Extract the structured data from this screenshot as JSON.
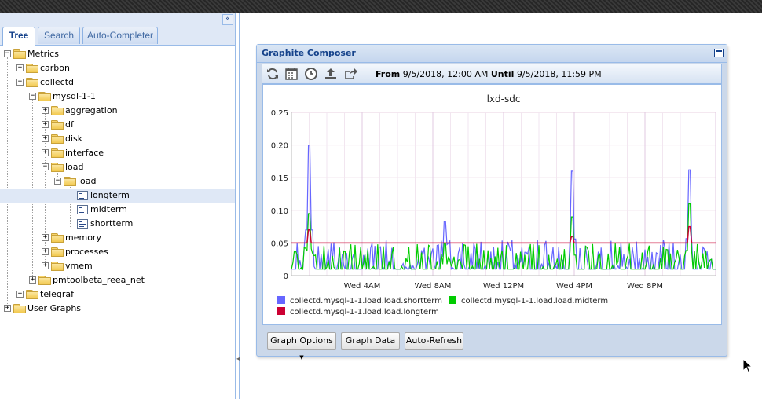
{
  "tabs": [
    {
      "label": "Tree",
      "active": true
    },
    {
      "label": "Search",
      "active": false
    },
    {
      "label": "Auto-Completer",
      "active": false
    }
  ],
  "tree": {
    "metrics": "Metrics",
    "carbon": "carbon",
    "collectd": "collectd",
    "mysql": "mysql-1-1",
    "aggregation": "aggregation",
    "df": "df",
    "disk": "disk",
    "interface": "interface",
    "load": "load",
    "load_inner": "load",
    "longterm": "longterm",
    "midterm": "midterm",
    "shortterm": "shortterm",
    "memory": "memory",
    "processes": "processes",
    "vmem": "vmem",
    "pmtoolbeta": "pmtoolbeta_reea_net",
    "telegraf": "telegraf",
    "user_graphs": "User Graphs"
  },
  "composer": {
    "title": "Graphite Composer",
    "range_from_label": "From",
    "range_from": "9/5/2018, 12:00 AM",
    "range_until_label": "Until",
    "range_until": "9/5/2018, 11:59 PM",
    "buttons": {
      "graph_options": "Graph Options",
      "graph_data": "Graph Data",
      "auto_refresh": "Auto-Refresh"
    },
    "toolbar_icons": [
      "refresh-icon",
      "calendar-icon",
      "clock-icon",
      "upload-icon",
      "share-icon"
    ]
  },
  "chart_data": {
    "type": "line",
    "title": "lxd-sdc",
    "ylim": [
      0,
      0.25
    ],
    "y_ticks": [
      "0.25",
      "0.20",
      "0.15",
      "0.10",
      "0.05",
      "0"
    ],
    "x_ticks": [
      "Wed  4AM",
      "Wed  8AM",
      "Wed 12PM",
      "Wed  4PM",
      "Wed  8PM"
    ],
    "x_hours": [
      4,
      8,
      12,
      16,
      20
    ],
    "xlim_hours": [
      0,
      24
    ],
    "series": [
      {
        "name": "collectd.mysql-1-1.load.load.shortterm",
        "color": "#6666ff",
        "peaks": [
          {
            "x": 1.0,
            "y": 0.2
          },
          {
            "x": 8.7,
            "y": 0.083
          },
          {
            "x": 15.9,
            "y": 0.16
          },
          {
            "x": 22.5,
            "y": 0.162
          }
        ],
        "baseline": 0.01,
        "noise_max": 0.045
      },
      {
        "name": "collectd.mysql-1-1.load.load.midterm",
        "color": "#00cc00",
        "peaks": [
          {
            "x": 1.0,
            "y": 0.095
          },
          {
            "x": 8.7,
            "y": 0.05
          },
          {
            "x": 15.9,
            "y": 0.09
          },
          {
            "x": 22.5,
            "y": 0.11
          }
        ],
        "baseline": 0.01,
        "noise_max": 0.04
      },
      {
        "name": "collectd.mysql-1-1.load.load.longterm",
        "color": "#cc0033",
        "level": 0.05,
        "peaks": [
          {
            "x": 1.0,
            "y": 0.07
          },
          {
            "x": 15.9,
            "y": 0.06
          },
          {
            "x": 22.5,
            "y": 0.075
          }
        ]
      }
    ],
    "legend_position": "bottom",
    "grid": true
  }
}
